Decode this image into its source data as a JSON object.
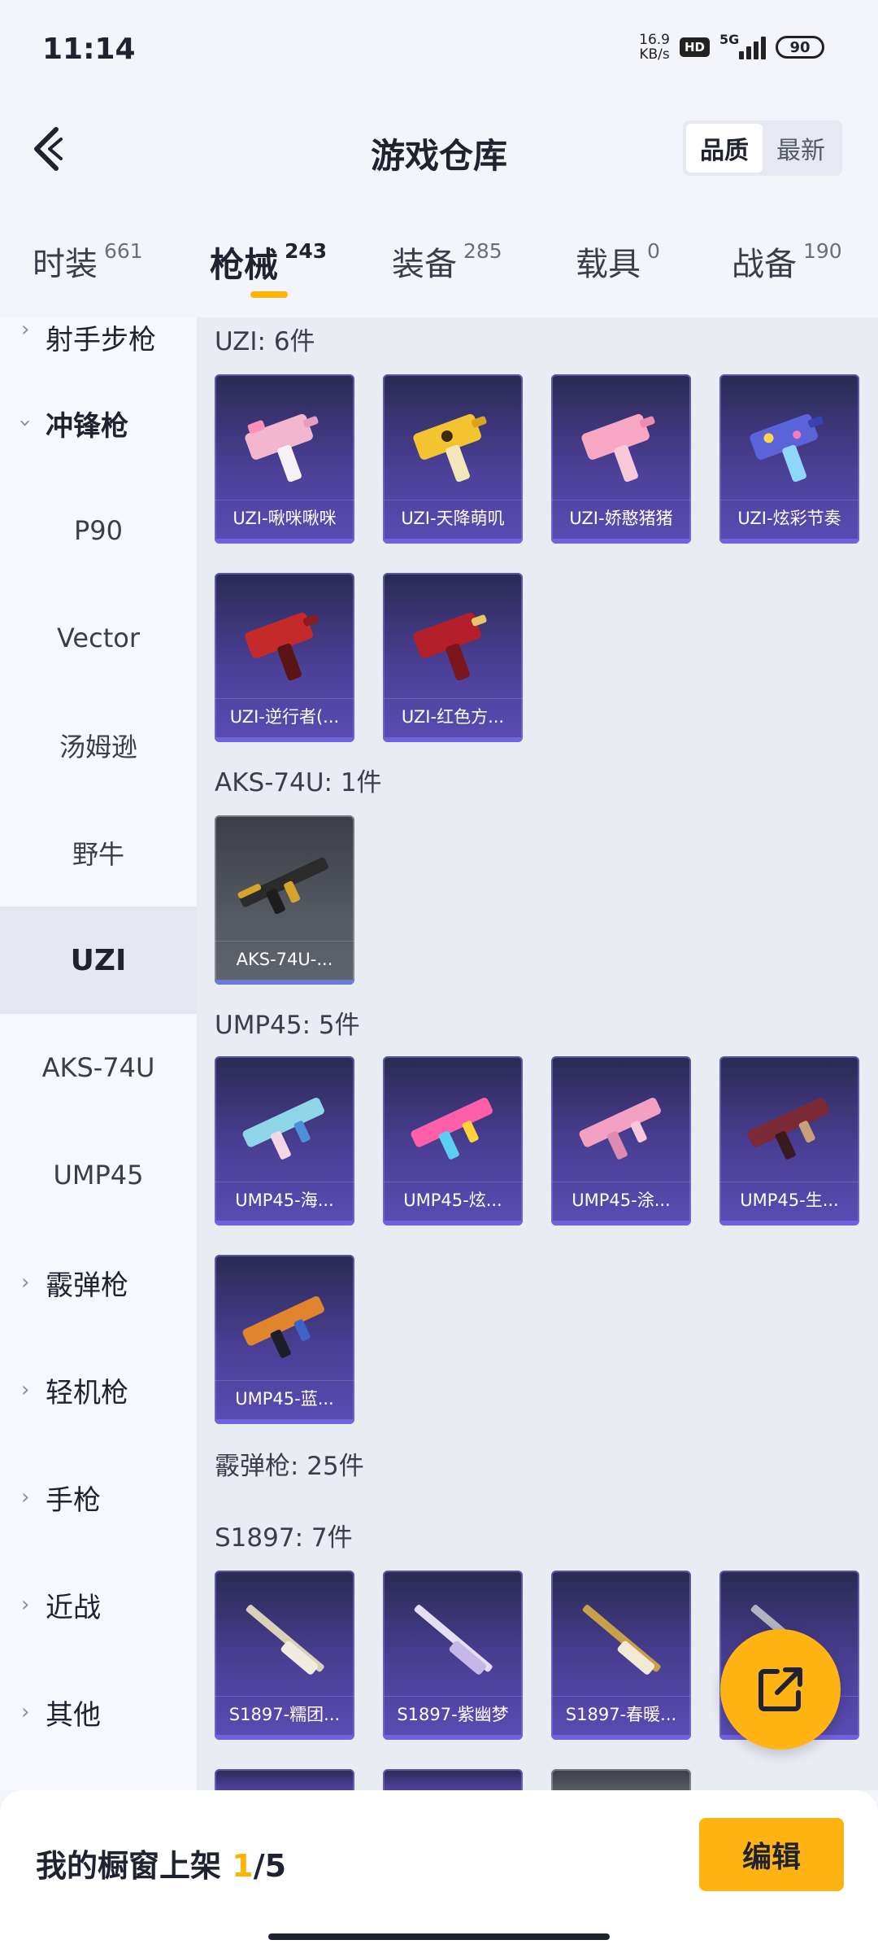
{
  "status": {
    "time": "11:14",
    "speed_value": "16.9",
    "speed_unit": "KB/s",
    "hd": "HD",
    "network": "5G",
    "battery": "90"
  },
  "header": {
    "title": "游戏仓库",
    "sort_quality": "品质",
    "sort_latest": "最新"
  },
  "tabs": [
    {
      "label": "时装",
      "count": "661"
    },
    {
      "label": "枪械",
      "count": "243"
    },
    {
      "label": "装备",
      "count": "285"
    },
    {
      "label": "载具",
      "count": "0"
    },
    {
      "label": "战备",
      "count": "190"
    }
  ],
  "sidebar": {
    "marksman": "射手步枪",
    "smg": "冲锋枪",
    "p90": "P90",
    "vector": "Vector",
    "thompson": "汤姆逊",
    "bizon": "野牛",
    "uzi": "UZI",
    "aks74u": "AKS-74U",
    "ump45": "UMP45",
    "shotgun": "霰弹枪",
    "lmg": "轻机枪",
    "pistol": "手枪",
    "melee": "近战",
    "other": "其他"
  },
  "groups": {
    "uzi_title": "UZI: 6件",
    "uzi_items": [
      "UZI-啾咪啾咪",
      "UZI-天降萌叽",
      "UZI-娇憨猪猪",
      "UZI-炫彩节奏",
      "UZI-逆行者(...",
      "UZI-红色方..."
    ],
    "aks_title": "AKS-74U: 1件",
    "aks_items": [
      "AKS-74U-..."
    ],
    "ump_title": "UMP45: 5件",
    "ump_items": [
      "UMP45-海...",
      "UMP45-炫...",
      "UMP45-涂...",
      "UMP45-生...",
      "UMP45-蓝..."
    ],
    "shotgun_title": "霰弹枪: 25件",
    "s1897_title": "S1897: 7件",
    "s1897_items": [
      "S1897-糯团...",
      "S1897-紫幽梦",
      "S1897-春暖...",
      "S..."
    ]
  },
  "bottom": {
    "shelf_label": "我的橱窗上架 ",
    "shelf_current": "1",
    "shelf_total": "/5",
    "edit_label": "编辑"
  },
  "colors": {
    "accent": "#ffb414",
    "card_purple": "#4b3f96",
    "card_gray": "#555961"
  }
}
